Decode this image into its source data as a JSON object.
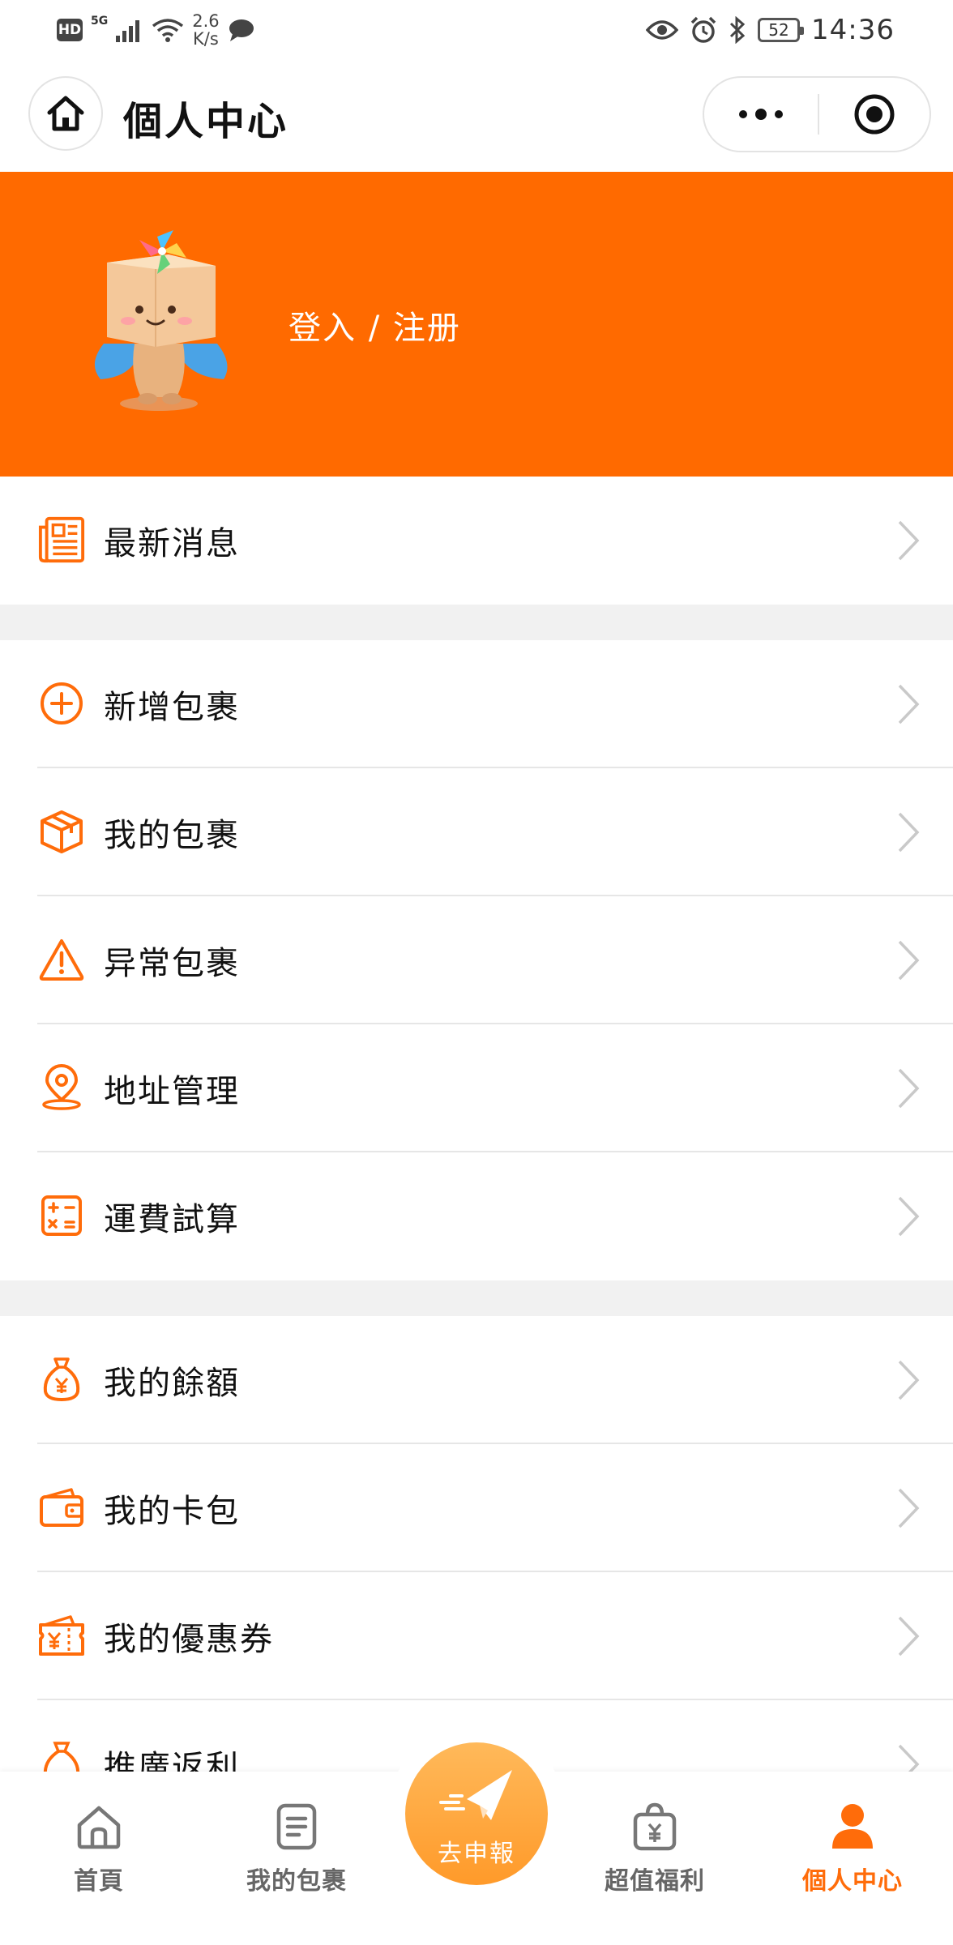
{
  "colors": {
    "brand": "#ff6c0a",
    "accent_light": "#ffa63a",
    "divider": "#e6e6e6",
    "gap": "#f1f1f1",
    "text": "#111111",
    "tab_inactive": "#666666"
  },
  "status_bar": {
    "left_badges": [
      "HD",
      "5G"
    ],
    "net_speed_value": "2.6",
    "net_speed_unit": "K/s",
    "battery": "52",
    "time": "14:36",
    "icons": [
      "signal-icon",
      "wifi-icon",
      "chat-icon",
      "eye-icon",
      "alarm-icon",
      "bluetooth-icon",
      "battery-icon"
    ]
  },
  "header": {
    "title": "個人中心",
    "home_icon": "home-icon",
    "more_icon": "more-dots-icon",
    "close_icon": "target-close-icon"
  },
  "profile": {
    "login_text": "登入 / 注册"
  },
  "menu_groups": [
    {
      "items": [
        {
          "label": "最新消息",
          "icon": "news-icon"
        }
      ]
    },
    {
      "items": [
        {
          "label": "新增包裹",
          "icon": "add-circle-icon"
        },
        {
          "label": "我的包裹",
          "icon": "package-icon"
        },
        {
          "label": "异常包裹",
          "icon": "warning-icon"
        },
        {
          "label": "地址管理",
          "icon": "location-icon"
        },
        {
          "label": "運費試算",
          "icon": "calculator-icon"
        }
      ]
    },
    {
      "items": [
        {
          "label": "我的餘額",
          "icon": "money-bag-icon"
        },
        {
          "label": "我的卡包",
          "icon": "wallet-icon"
        },
        {
          "label": "我的優惠券",
          "icon": "coupon-icon"
        },
        {
          "label": "推廣返利",
          "icon": "rebate-icon"
        }
      ]
    }
  ],
  "tabbar": {
    "tabs": [
      {
        "label": "首頁",
        "icon": "home-outline-icon",
        "active": false
      },
      {
        "label": "我的包裹",
        "icon": "document-icon",
        "active": false
      },
      {
        "label": "超值福利",
        "icon": "gift-bag-icon",
        "active": false
      },
      {
        "label": "個人中心",
        "icon": "person-icon",
        "active": true
      }
    ],
    "center": {
      "label": "去申報",
      "icon": "paper-plane-icon"
    }
  }
}
